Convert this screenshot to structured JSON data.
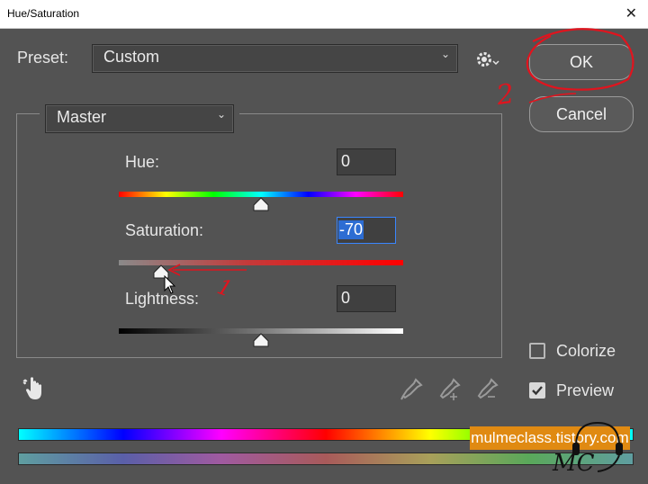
{
  "window": {
    "title": "Hue/Saturation"
  },
  "preset": {
    "label": "Preset:",
    "value": "Custom"
  },
  "channel": {
    "value": "Master"
  },
  "buttons": {
    "ok": "OK",
    "cancel": "Cancel"
  },
  "hue": {
    "label": "Hue:",
    "value": "0",
    "level": 0.5
  },
  "saturation": {
    "label": "Saturation:",
    "value": "-70",
    "level": 0.15
  },
  "lightness": {
    "label": "Lightness:",
    "value": "0",
    "level": 0.5
  },
  "options": {
    "colorize_label": "Colorize",
    "colorize_checked": false,
    "preview_label": "Preview",
    "preview_checked": true
  },
  "annotations": {
    "step1": "1",
    "step2": "2"
  },
  "watermark": {
    "text": "mulmeclass.tistory.com",
    "logo": "MC"
  },
  "icons": [
    "close-icon",
    "gear-icon",
    "chevron-down-icon",
    "hand-adjust-icon",
    "eyedropper-icon",
    "eyedropper-plus-icon",
    "eyedropper-minus-icon",
    "check-icon",
    "cursor-icon"
  ],
  "colors": {
    "dialog_bg": "#535353",
    "annotation_red": "#e0141e",
    "watermark_bg": "#e08a12"
  }
}
